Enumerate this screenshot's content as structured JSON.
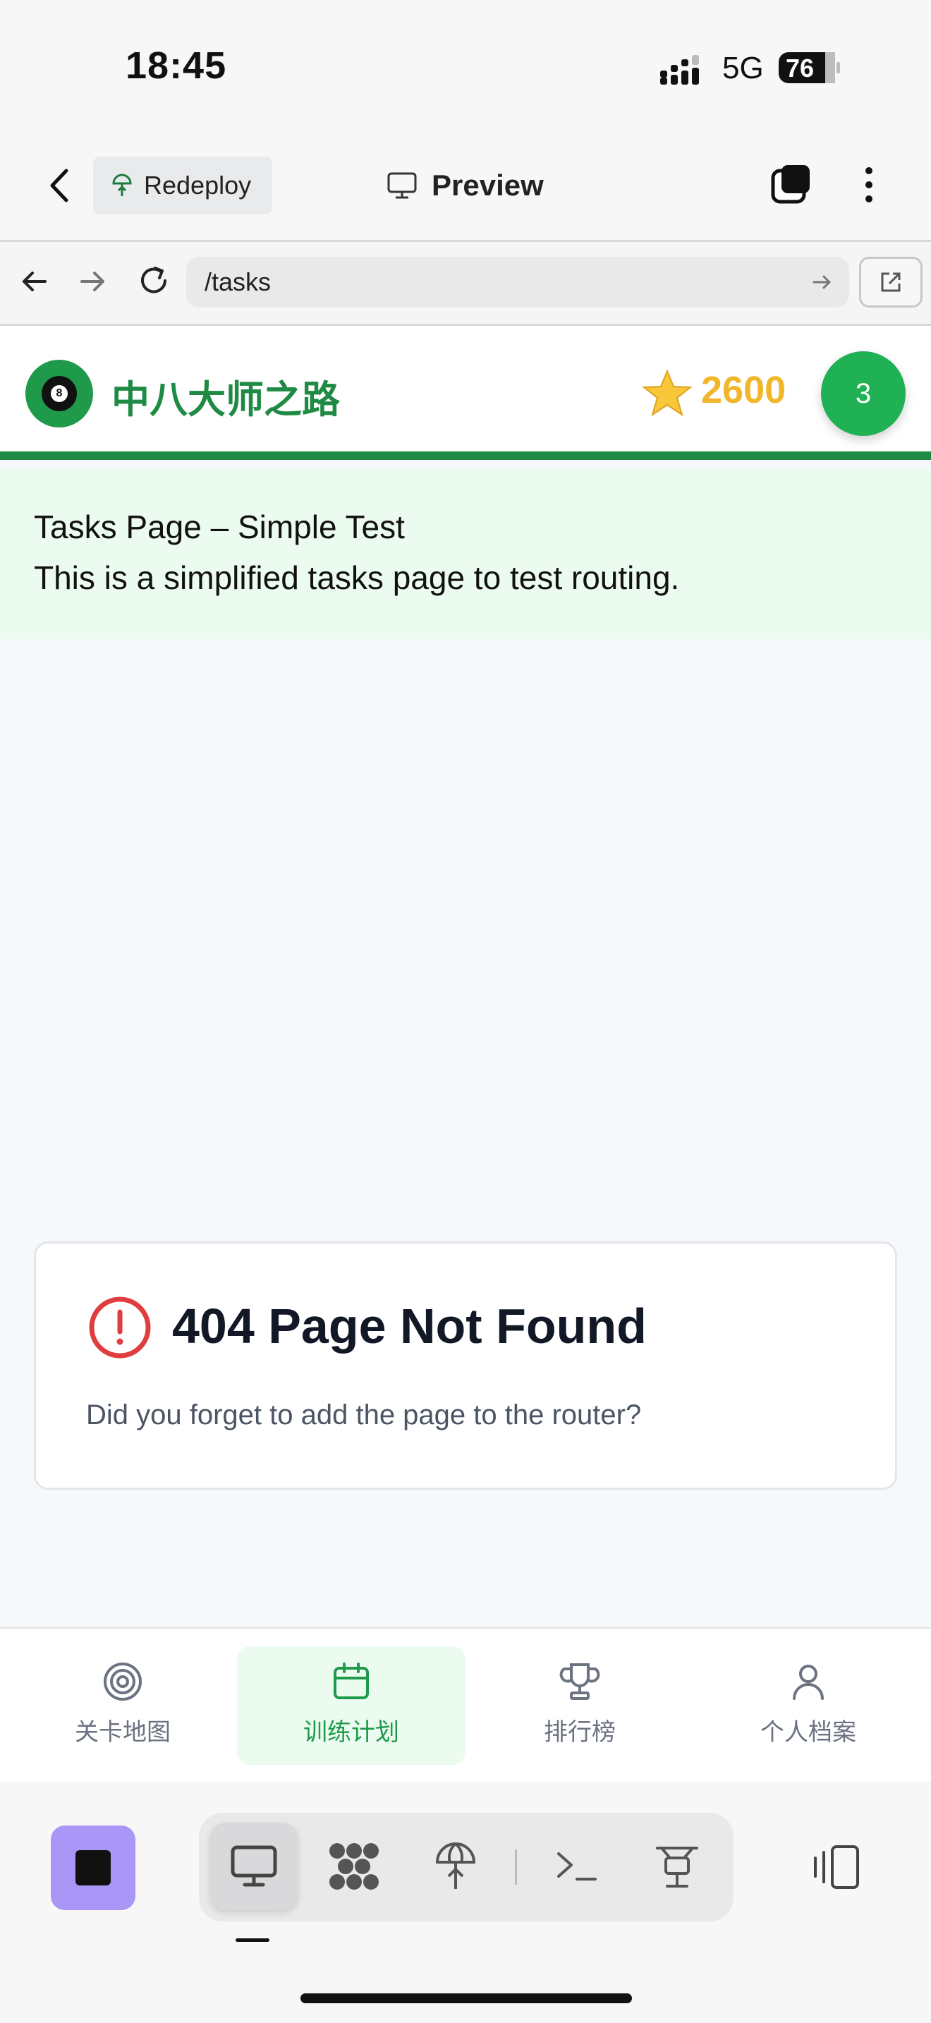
{
  "status_bar": {
    "time": "18:45",
    "network": "5G",
    "battery": "76"
  },
  "app_header": {
    "redeploy_label": "Redeploy",
    "title": "Preview"
  },
  "url_bar": {
    "url": "/tasks"
  },
  "site": {
    "title": "中八大师之路",
    "score": "2600",
    "level": "3",
    "colors": {
      "brand": "#1e8a43",
      "score": "#f2b62b",
      "badge": "#1fb154"
    }
  },
  "banner": {
    "line1": "Tasks Page – Simple Test",
    "line2": "This is a simplified tasks page to test routing."
  },
  "error_card": {
    "title": "404 Page Not Found",
    "description": "Did you forget to add the page to the router?",
    "icon": "alert-circle-icon"
  },
  "tabs": [
    {
      "label": "关卡地图",
      "icon": "target-icon",
      "active": false
    },
    {
      "label": "训练计划",
      "icon": "calendar-icon",
      "active": true
    },
    {
      "label": "排行榜",
      "icon": "trophy-icon",
      "active": false
    },
    {
      "label": "个人档案",
      "icon": "user-icon",
      "active": false
    }
  ],
  "dev_toolbar": {
    "tools": [
      "monitor-icon",
      "apps-icon",
      "deploy-icon",
      "terminal-icon",
      "network-icon"
    ],
    "active_tool": "monitor-icon"
  }
}
